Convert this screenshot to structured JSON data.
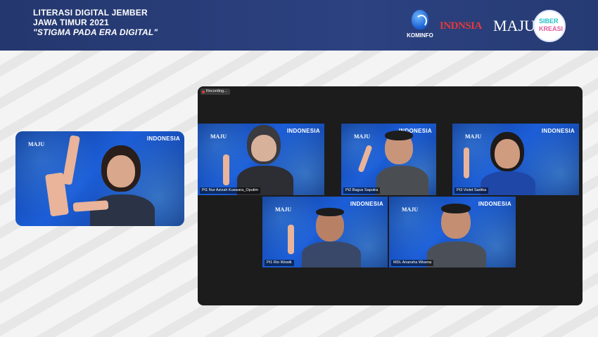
{
  "header": {
    "title_line1": "LITERASI DIGITAL JEMBER",
    "title_line2": "JAWA TIMUR 2021",
    "title_line3": "\"STIGMA PADA ERA DIGITAL\"",
    "logos": {
      "kominfo": "KOMINFO",
      "indonesia": "INDNSIA",
      "maju": "MAJU",
      "siber_line1": "SIBER",
      "siber_line2": "KREASI"
    }
  },
  "tile_brand": "INDONESIA",
  "meeting": {
    "recording_label": "Recording...",
    "participants": [
      {
        "label": "Pt1 Nur Azizah Kuswara_Oputim"
      },
      {
        "label": "Pt2 Bagus Saputra"
      },
      {
        "label": "Pt3 Violet Sartika"
      },
      {
        "label": "Pt1 Rio Wowik"
      },
      {
        "label": "MDL Ariansha Wisena"
      }
    ]
  },
  "colors": {
    "header_bg": "#2a3f7c",
    "tile_bg": "#1c5ed8",
    "zoom_bg": "#1c1c1c"
  }
}
